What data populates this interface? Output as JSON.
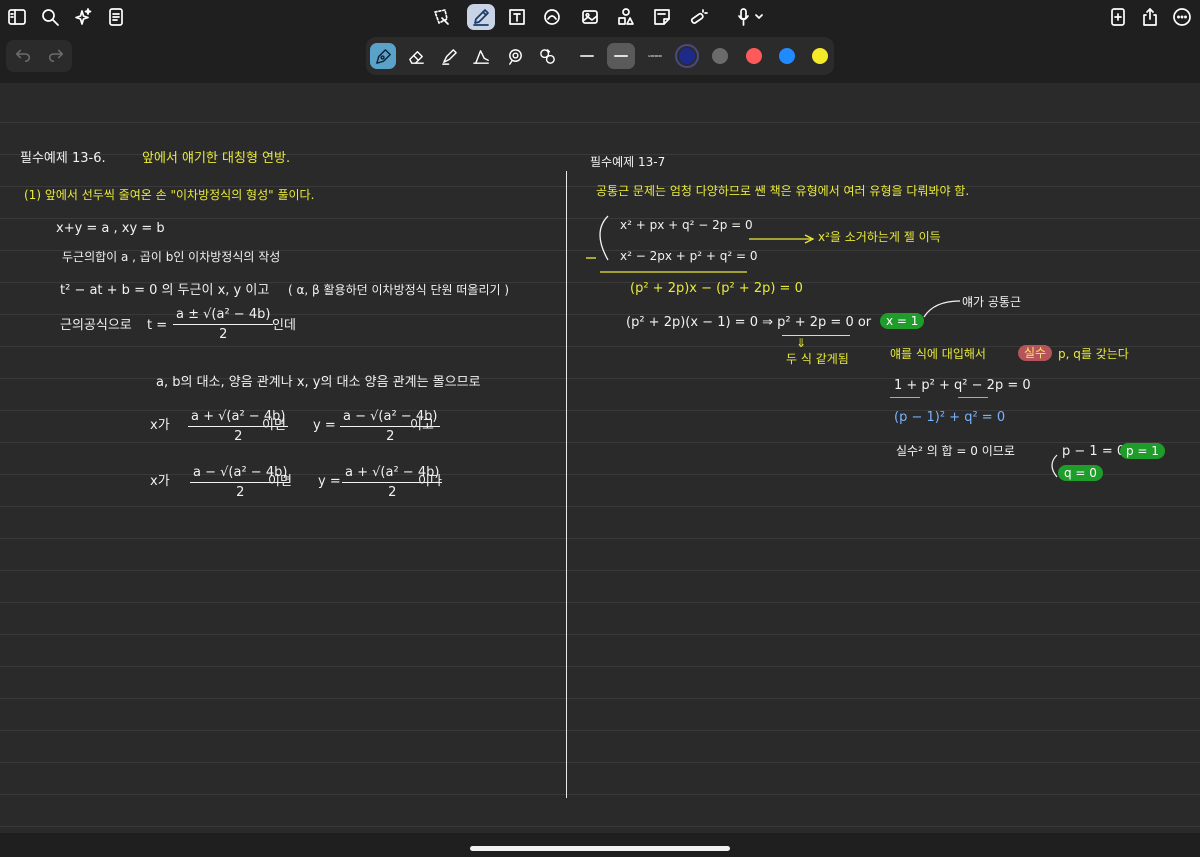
{
  "topbar": {
    "left_icons": [
      "sidebar-icon",
      "search-icon",
      "sparkle-icon",
      "document-icon"
    ],
    "center_icons": [
      "lasso-icon",
      "pen-icon",
      "textbox-icon",
      "shapes-icon",
      "image-icon",
      "elements-icon",
      "sticky-note-icon",
      "laser-icon",
      "microphone-icon"
    ],
    "right_icons": [
      "add-page-icon",
      "share-icon",
      "more-icon"
    ]
  },
  "toolbar": {
    "tools": [
      "fountain-pen-icon",
      "eraser-icon",
      "highlighter-icon",
      "shape-tool-icon",
      "lasso-tool-icon",
      "laser-tool-icon"
    ],
    "colors": [
      "#1e2a8a",
      "#6b6b6b",
      "#ff5a5a",
      "#1f8bff",
      "#f4ea2a"
    ],
    "selected_color": "#1e2a8a"
  },
  "left": {
    "title": "필수예제 13-6.",
    "title_note": "앞에서 얘기한 대칭형 연방.",
    "step1": "(1) 앞에서 선두씩 줄여온 손 \"이차방정식의 형성\" 풀이다.",
    "line_a": "x+y = a ,   xy = b",
    "line_b": "두근의합이 a , 곱이 b인  이차방정식의 작성",
    "eq_t": "t² − at + b = 0  의 두근이  x, y 이고",
    "eq_t_note": "( α, β 활용하던 이차방정식 단원 떠올리기 )",
    "formula_prefix": "근의공식으로",
    "formula_t": "t =",
    "formula_num": "a ± √(a² − 4b)",
    "formula_den": "2",
    "formula_suffix": "인데",
    "note_order": "a, b의 대소, 양음 관계나      x, y의 대소 양음 관계는 몰으므로",
    "case1_prefix": "x가",
    "case1_x_num": "a + √(a² − 4b)",
    "case1_x_den": "2",
    "case1_mid": "이면",
    "case1_y": "y =",
    "case1_y_num": "a − √(a² − 4b)",
    "case1_y_den": "2",
    "case1_suffix": "이고",
    "case2_prefix": "x가",
    "case2_x_num": "a − √(a² − 4b)",
    "case2_x_den": "2",
    "case2_mid": "이면",
    "case2_y": "y =",
    "case2_y_num": "a + √(a² − 4b)",
    "case2_y_den": "2",
    "case2_suffix": "이다"
  },
  "right": {
    "title": "필수예제 13-7",
    "intro": "공통근 문제는 엄청 다양하므로  쌘 책은 유형에서 여러 유형을 다뤄봐야 함.",
    "sys1": "x² + px + q² − 2p = 0",
    "sys2": "x² − 2px + p² + q² = 0",
    "arrow_note": "x²을 소거하는게 젤 이득",
    "step_sub": "(p² + 2p)x − (p² + 2p) = 0",
    "factor": "(p² + 2p)(x − 1) = 0  ⇒  p² + 2p = 0   or",
    "factor_hl": "x = 1",
    "common_note": "얘가 공통근",
    "down_note": "두 식 같게됨",
    "subst_text": "얘를  식에 대입해서",
    "subst_hl": "실수",
    "subst_end": "p, q를 갖는다",
    "eq1": "1 + p² + q² − 2p = 0",
    "eq2": "(p − 1)² + q² = 0",
    "sum_text": "실수² 의 합 = 0  이므로",
    "res1": "p − 1 = 0 ,",
    "res1_hl": "p = 1",
    "res2_hl": "q = 0"
  }
}
